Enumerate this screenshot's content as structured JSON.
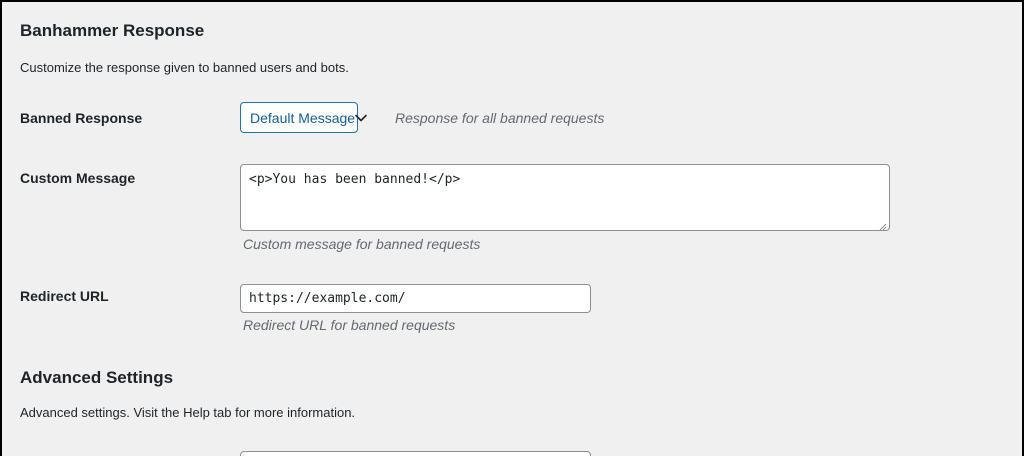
{
  "response_section": {
    "title": "Banhammer Response",
    "description": "Customize the response given to banned users and bots.",
    "banned_response": {
      "label": "Banned Response",
      "selected": "Default Message",
      "hint": "Response for all banned requests"
    },
    "custom_message": {
      "label": "Custom Message",
      "value": "<p>You has been banned!</p>",
      "hint": "Custom message for banned requests"
    },
    "redirect_url": {
      "label": "Redirect URL",
      "value": "https://example.com/",
      "hint": "Redirect URL for banned requests"
    }
  },
  "advanced_section": {
    "title": "Advanced Settings",
    "description": "Advanced settings. Visit the Help tab for more information."
  },
  "icons": {
    "select_arrow": "chevron-down-icon",
    "resize": "resize-grip-icon"
  },
  "colors": {
    "accent": "#2271b1",
    "background": "#f0f0f1",
    "text": "#1d2327",
    "hint": "#646970",
    "border": "#8c8f94"
  }
}
